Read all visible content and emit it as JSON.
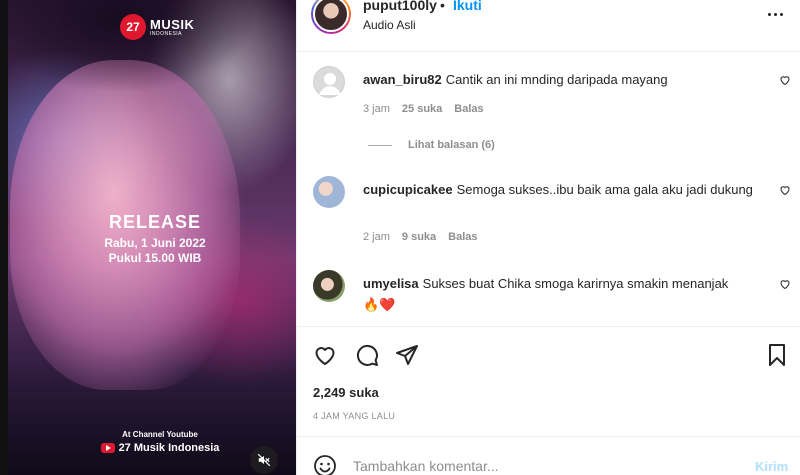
{
  "media": {
    "brand_number": "27",
    "brand_name": "MUSIK",
    "brand_sub": "INDONESIA",
    "release_title": "RELEASE",
    "release_date": "Rabu, 1 Juni 2022",
    "release_time": "Pukul 15.00 WIB",
    "channel_line": "At Channel Youtube",
    "channel_name": "27 Musik Indonesia",
    "mute_icon": "speaker-muted-icon"
  },
  "header": {
    "username": "puput100ly",
    "separator": "•",
    "follow_label": "Ikuti",
    "audio": "Audio Asli",
    "more_icon": "more-horizontal-icon"
  },
  "comments": [
    {
      "username": "awan_biru82",
      "text": "Cantik an ini mnding daripada mayang",
      "time": "3 jam",
      "likes": "25 suka",
      "reply_label": "Balas"
    },
    {
      "username": "cupicupicakee",
      "text": "Semoga sukses..ibu baik ama gala aku jadi dukung",
      "time": "2 jam",
      "likes": "9 suka",
      "reply_label": "Balas"
    },
    {
      "username": "umyelisa",
      "text": "Sukses buat Chika smoga karirnya smakin menanjak",
      "emoji": "🔥❤️"
    }
  ],
  "view_replies_label": "Lihat balasan (6)",
  "actions": {
    "like_icon": "heart-icon",
    "comment_icon": "comment-icon",
    "share_icon": "send-icon",
    "save_icon": "bookmark-icon",
    "likes_count": "2,249 suka",
    "time_ago": "4 JAM YANG LALU"
  },
  "add_comment": {
    "emoji_icon": "smiley-icon",
    "placeholder": "Tambahkan komentar...",
    "post_label": "Kirim"
  },
  "colors": {
    "link_blue": "#0095f6",
    "muted_text": "#8e8e8e",
    "post_disabled": "#b2dffc",
    "brand_red": "#e0182d"
  }
}
